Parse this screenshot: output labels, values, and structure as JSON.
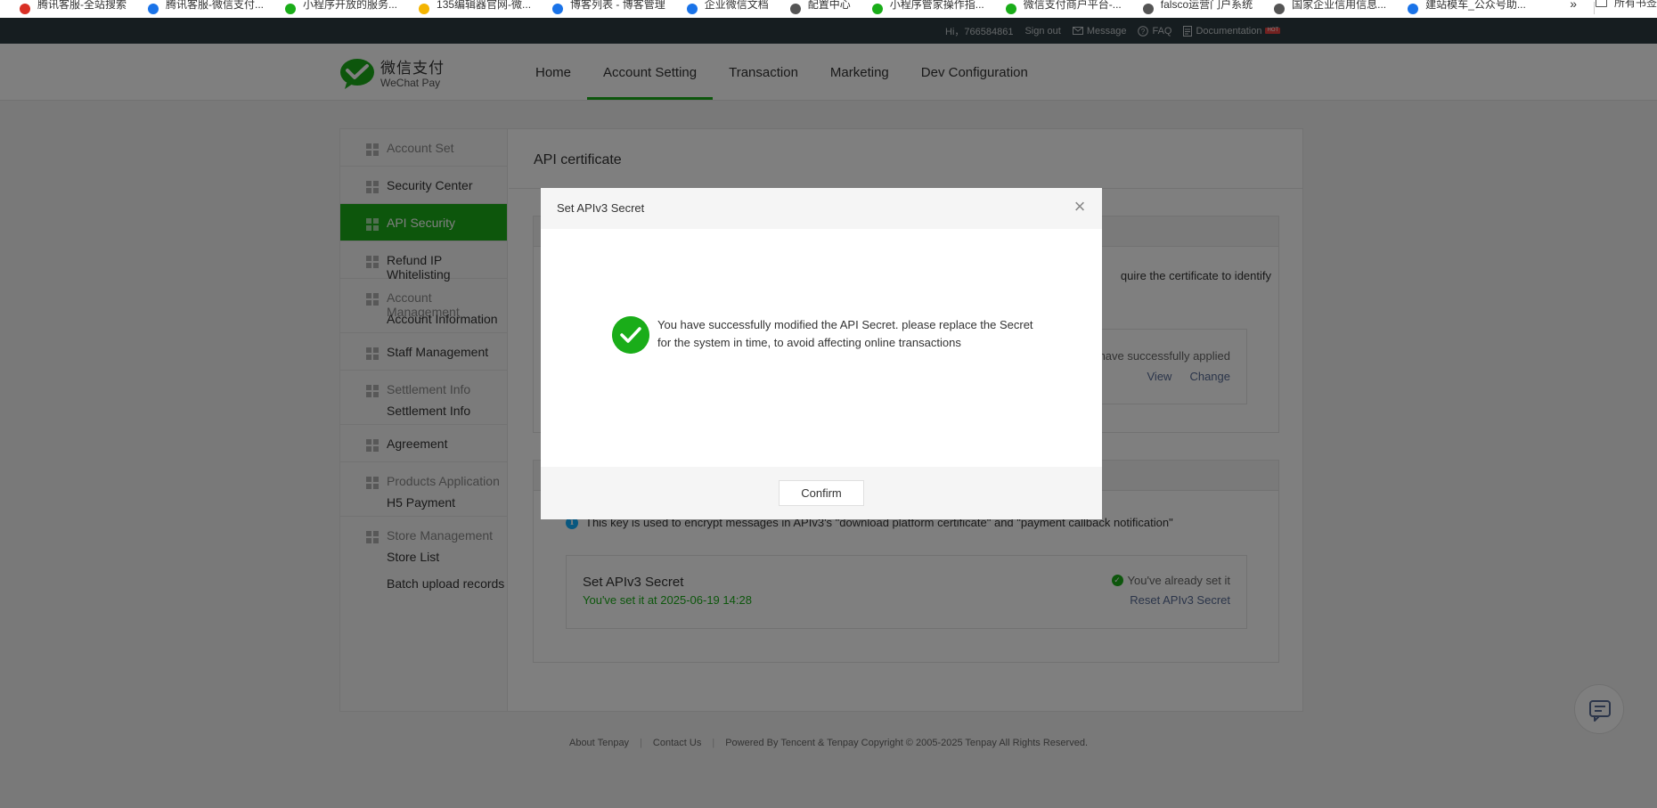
{
  "bookmarks": {
    "items": [
      {
        "label": "腾讯客服-全站搜索",
        "color": "#d93025"
      },
      {
        "label": "腾讯客服-微信支付...",
        "color": "#1a73e8"
      },
      {
        "label": "小程序开放的服务...",
        "color": "#1aad19"
      },
      {
        "label": "135编辑器官网-微...",
        "color": "#f4b400"
      },
      {
        "label": "博客列表 - 博客管理",
        "color": "#1a73e8"
      },
      {
        "label": "企业微信文档",
        "color": "#1a73e8"
      },
      {
        "label": "配置中心",
        "color": "#555555"
      },
      {
        "label": "小程序管家操作指...",
        "color": "#1aad19"
      },
      {
        "label": "微信支付商户平台-...",
        "color": "#1aad19"
      },
      {
        "label": "falsco运营门户系统",
        "color": "#555555"
      },
      {
        "label": "国家企业信用信息...",
        "color": "#555555"
      },
      {
        "label": "建站模车_公众号助...",
        "color": "#1a73e8"
      }
    ],
    "more": "»",
    "all_label": "所有书签"
  },
  "topbar": {
    "greeting": "Hi，766584861",
    "signout": "Sign out",
    "message": "Message",
    "faq": "FAQ",
    "documentation": "Documentation",
    "hot_badge": "HOT"
  },
  "header": {
    "logo_cn": "微信支付",
    "logo_en": "WeChat Pay",
    "nav": [
      {
        "label": "Home"
      },
      {
        "label": "Account Setting"
      },
      {
        "label": "Transaction"
      },
      {
        "label": "Marketing"
      },
      {
        "label": "Dev Configuration"
      }
    ]
  },
  "sidebar": {
    "account_set": "Account Set",
    "security_center": "Security Center",
    "api_security": "API Security",
    "refund_ip": "Refund IP Whitelisting",
    "account_management": "Account Management",
    "account_information": "Account Information",
    "staff_management": "Staff Management",
    "settlement_info_group": "Settlement Info",
    "settlement_info": "Settlement Info",
    "agreement": "Agreement",
    "products_application": "Products Application",
    "h5_payment": "H5 Payment",
    "store_management": "Store Management",
    "store_list": "Store List",
    "batch_upload": "Batch upload records"
  },
  "content": {
    "title": "API certificate",
    "cert_desc_partial": "quire the certificate to identify",
    "cert_applied_partial": "have successfully applied",
    "view": "View",
    "change": "Change",
    "v3_info": "This key is used to encrypt messages in APIv3's \"download platform certificate\" and \"payment callback notification\"",
    "v3_title": "Set APIv3 Secret",
    "v3_date": "You've set it at 2025-06-19 14:28",
    "v3_status": "You've already set it",
    "v3_reset": "Reset APIv3 Secret"
  },
  "footer": {
    "about": "About Tenpay",
    "contact": "Contact Us",
    "copyright": "Powered By Tencent & Tenpay Copyright © 2005-2025 Tenpay All Rights Reserved."
  },
  "dialog": {
    "title": "Set APIv3 Secret",
    "message_line1": "You have successfully modified the API Secret. please replace the Secret",
    "message_line2": "for the system in time, to avoid affecting online transactions",
    "confirm": "Confirm"
  },
  "colors": {
    "brand_green": "#1aad19",
    "link_blue": "#576b95",
    "topbar_bg": "#2d3a40"
  }
}
